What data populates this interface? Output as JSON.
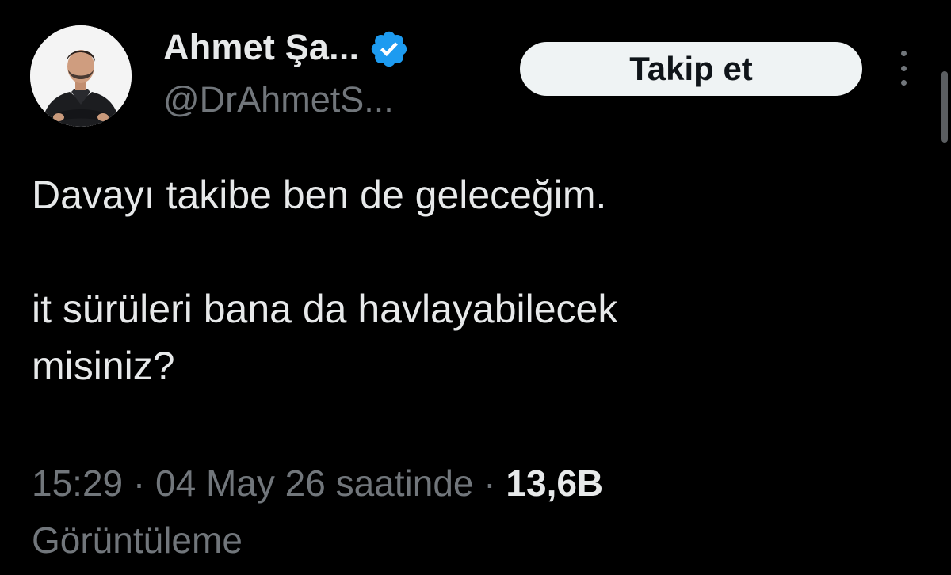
{
  "author": {
    "display_name": "Ahmet Şa...",
    "handle": "@DrAhmetS...",
    "verified_icon": "verified-badge-icon",
    "verified_color": "#1d9bf0"
  },
  "actions": {
    "follow_label": "Takip et",
    "more_icon": "more-vertical-icon"
  },
  "tweet": {
    "line1": "Davayı takibe ben de geleceğim.",
    "line2": "it sürüleri bana da havlayabilecek",
    "line3": "misiniz?"
  },
  "meta": {
    "time": "15:29",
    "separator1": " · ",
    "date": "04 May 26 saatinde",
    "separator2": " · ",
    "views_count": "13,6B",
    "views_label": "Görüntüleme"
  },
  "colors": {
    "background": "#000000",
    "text_primary": "#e7e9ea",
    "text_secondary": "#71767b",
    "button_bg": "#eff3f4"
  }
}
